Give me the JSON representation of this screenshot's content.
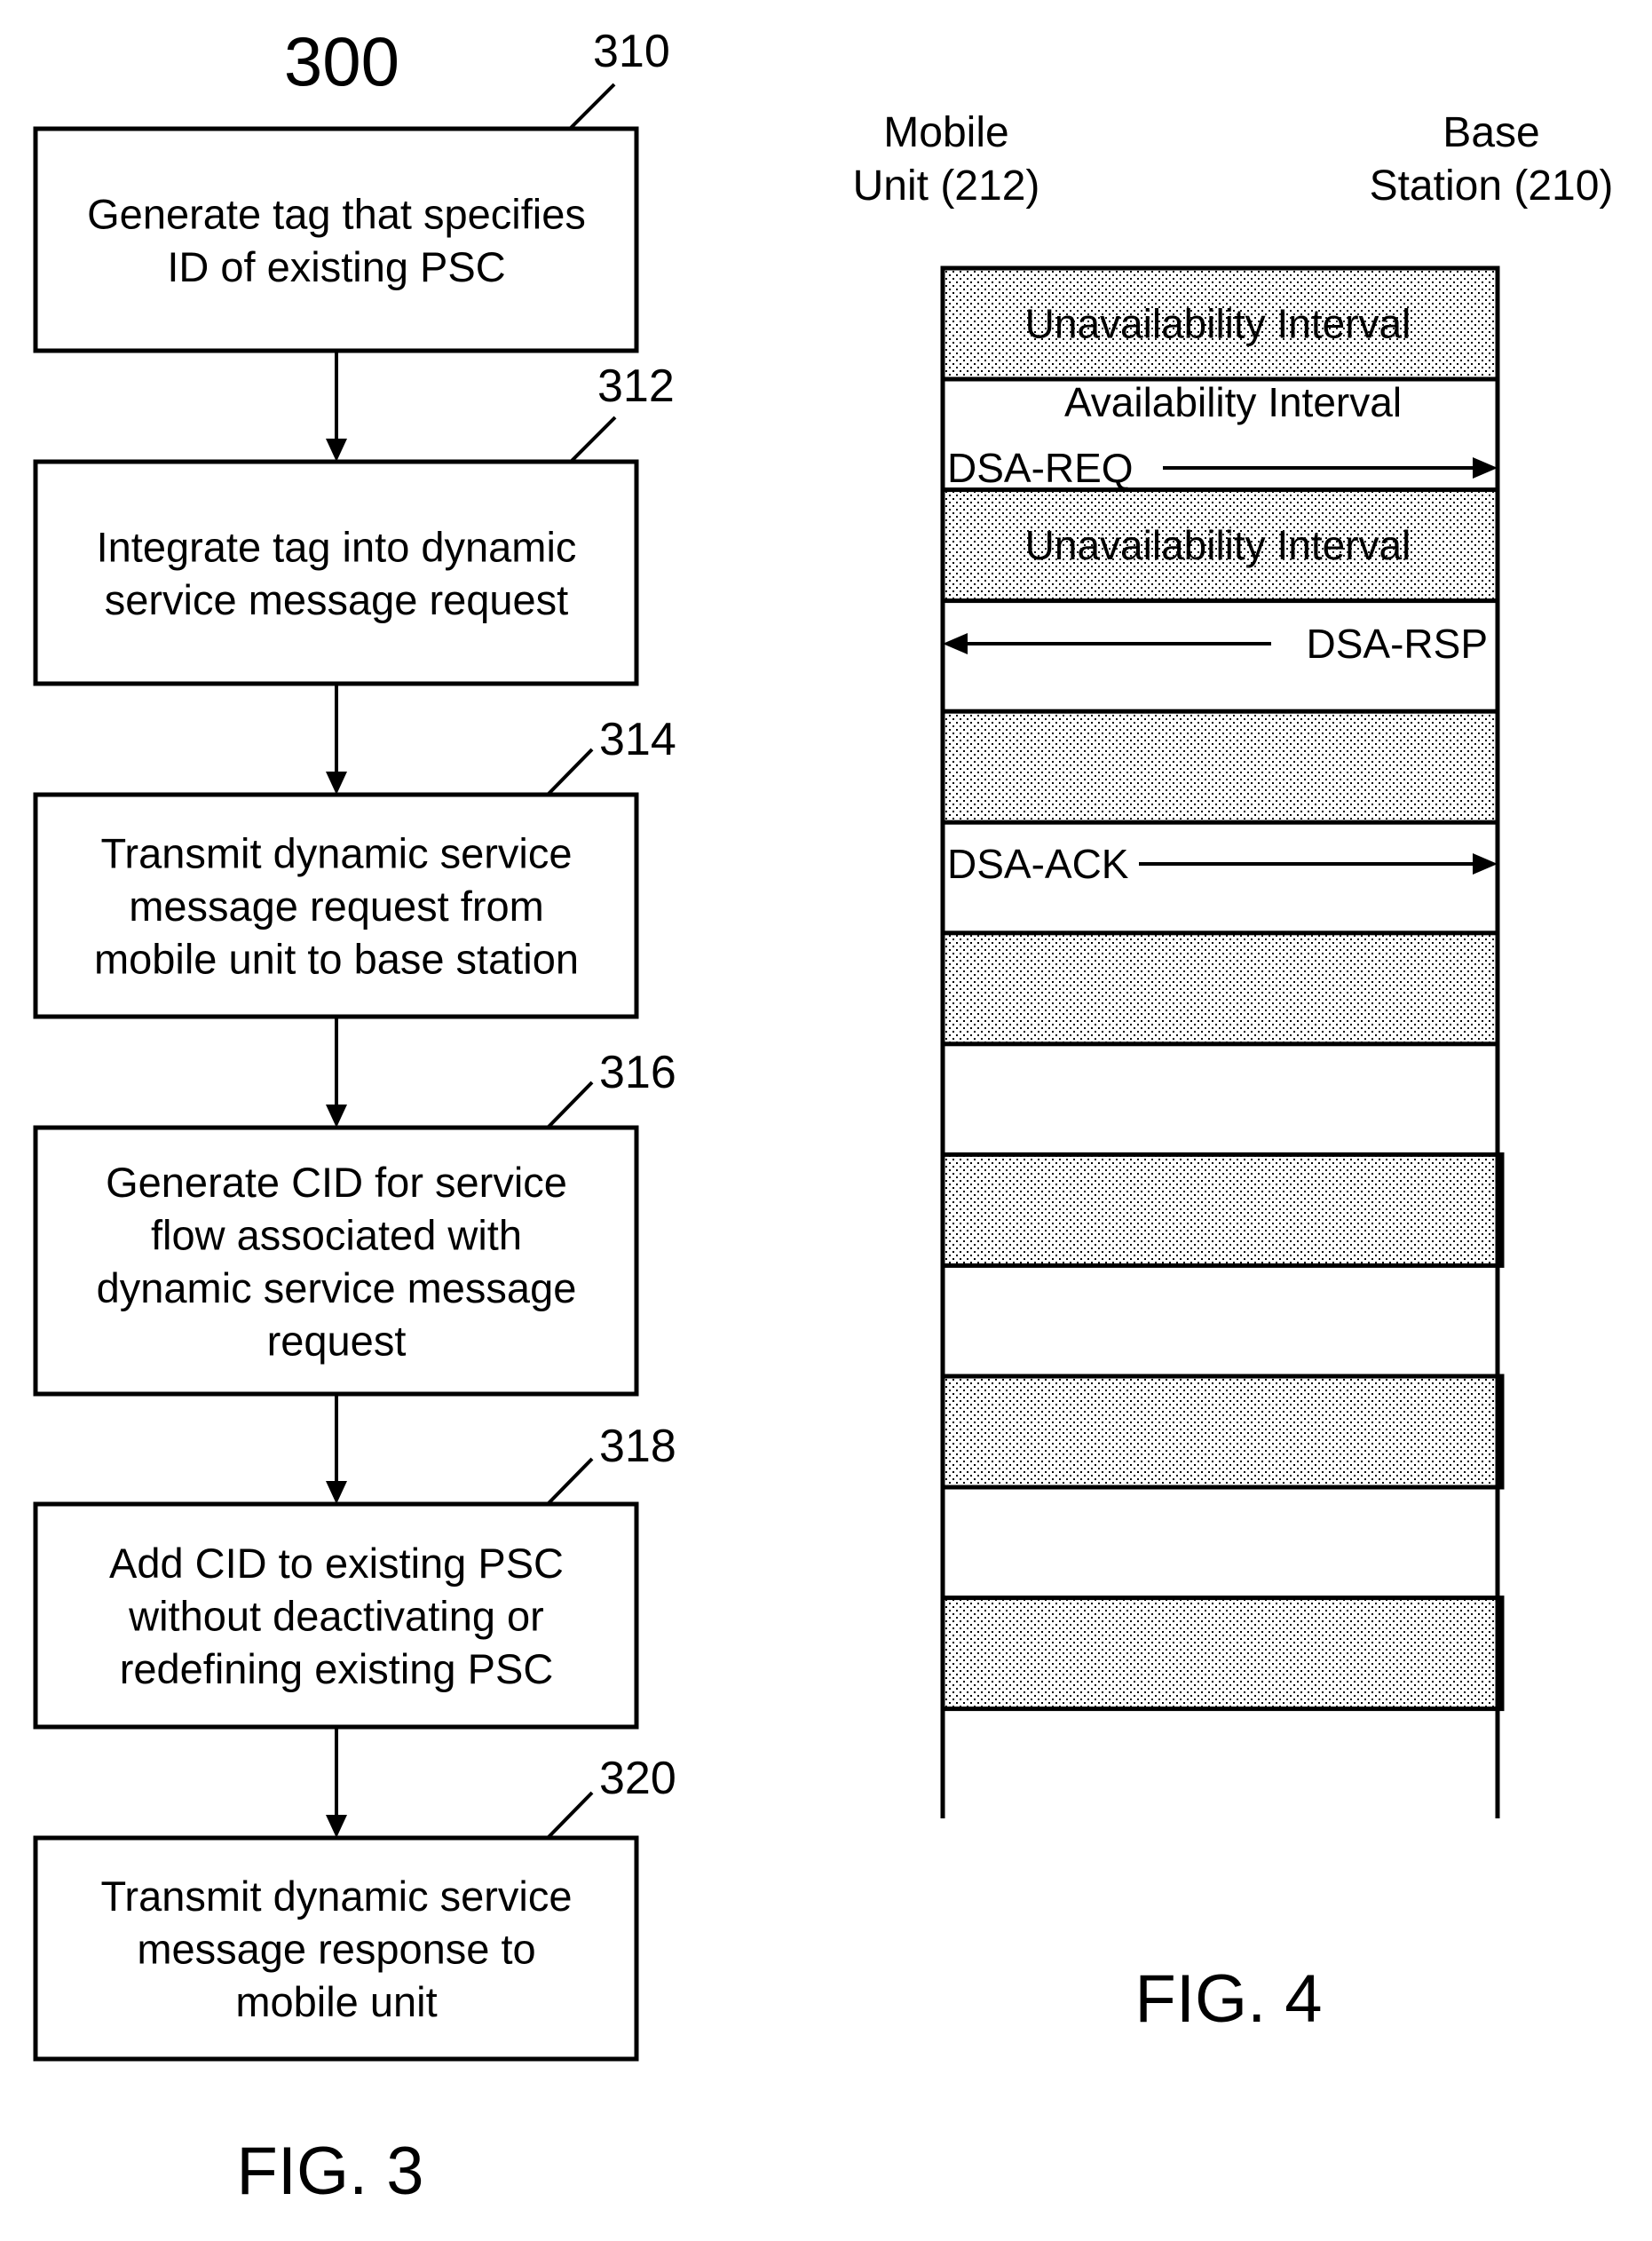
{
  "figure3": {
    "title": "300",
    "caption": "FIG. 3",
    "steps": [
      {
        "ref": "310",
        "lines": [
          "Generate tag that specifies",
          "ID of existing PSC"
        ]
      },
      {
        "ref": "312",
        "lines": [
          "Integrate tag into dynamic",
          "service message request"
        ]
      },
      {
        "ref": "314",
        "lines": [
          "Transmit dynamic service",
          "message request from",
          "mobile unit to base station"
        ]
      },
      {
        "ref": "316",
        "lines": [
          "Generate CID for service",
          "flow associated with",
          "dynamic service message",
          "request"
        ]
      },
      {
        "ref": "318",
        "lines": [
          "Add CID to existing PSC",
          "without deactivating or",
          "redefining existing PSC"
        ]
      },
      {
        "ref": "320",
        "lines": [
          "Transmit dynamic service",
          "message response to",
          "mobile unit"
        ]
      }
    ]
  },
  "figure4": {
    "caption": "FIG. 4",
    "participants": [
      {
        "id": "mobile",
        "lines": [
          "Mobile",
          "Unit (212)"
        ]
      },
      {
        "id": "base",
        "lines": [
          "Base",
          "Station (210)"
        ]
      }
    ],
    "intervals": [
      {
        "type": "unavailable",
        "label": "Unavailability Interval"
      },
      {
        "type": "available",
        "label": "Availability Interval"
      },
      {
        "type": "unavailable",
        "label": "Unavailability Interval"
      },
      {
        "type": "available",
        "label": ""
      },
      {
        "type": "unavailable",
        "label": ""
      },
      {
        "type": "available",
        "label": ""
      },
      {
        "type": "unavailable",
        "label": ""
      },
      {
        "type": "available",
        "label": ""
      },
      {
        "type": "unavailable",
        "label": ""
      },
      {
        "type": "available",
        "label": ""
      },
      {
        "type": "unavailable",
        "label": ""
      },
      {
        "type": "available",
        "label": ""
      },
      {
        "type": "unavailable",
        "label": ""
      }
    ],
    "messages": [
      {
        "label": "DSA-REQ",
        "from": "mobile",
        "to": "base",
        "interval_index": 1
      },
      {
        "label": "DSA-RSP",
        "from": "base",
        "to": "mobile",
        "interval_index": 3
      },
      {
        "label": "DSA-ACK",
        "from": "mobile",
        "to": "base",
        "interval_index": 5
      }
    ]
  }
}
